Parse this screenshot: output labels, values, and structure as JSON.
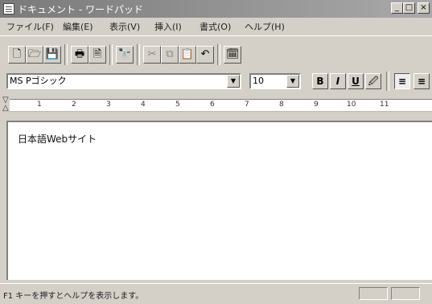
{
  "window": {
    "title": "ドキュメント - ワードパッド",
    "controls": {
      "minimize": "_",
      "maximize": "□",
      "close": "×"
    }
  },
  "menu": {
    "items": [
      "ファイル(F)",
      "編集(E)",
      "表示(V)",
      "挿入(I)",
      "書式(O)",
      "ヘルプ(H)"
    ]
  },
  "toolbar": {
    "buttons": [
      {
        "icon": "new-document-icon",
        "glyph": "🗋"
      },
      {
        "icon": "open-folder-icon",
        "glyph": "🗁"
      },
      {
        "icon": "save-disk-icon",
        "glyph": "💾"
      },
      {
        "icon": "print-icon",
        "glyph": "🖶"
      },
      {
        "icon": "print-preview-icon",
        "glyph": "🗎"
      },
      {
        "icon": "find-binoculars-icon",
        "glyph": "🔭"
      },
      {
        "icon": "cut-icon",
        "glyph": "✂"
      },
      {
        "icon": "copy-icon",
        "glyph": "⧉"
      },
      {
        "icon": "paste-icon",
        "glyph": "📋"
      },
      {
        "icon": "undo-icon",
        "glyph": "↶"
      },
      {
        "icon": "insert-datetime-icon",
        "glyph": "🗓"
      }
    ]
  },
  "format": {
    "font_name": "MS Pゴシック",
    "font_size": "10",
    "bold": "B",
    "italic": "I",
    "underline": "U",
    "color": "🖉",
    "align_left": "≡"
  },
  "ruler": {
    "labels": [
      "1",
      "2",
      "3",
      "4",
      "5",
      "6",
      "7",
      "8",
      "9",
      "10",
      "11"
    ]
  },
  "document": {
    "text": "日本語Webサイト"
  },
  "status": {
    "text": "F1 キーを押すとヘルプを表示します。"
  }
}
